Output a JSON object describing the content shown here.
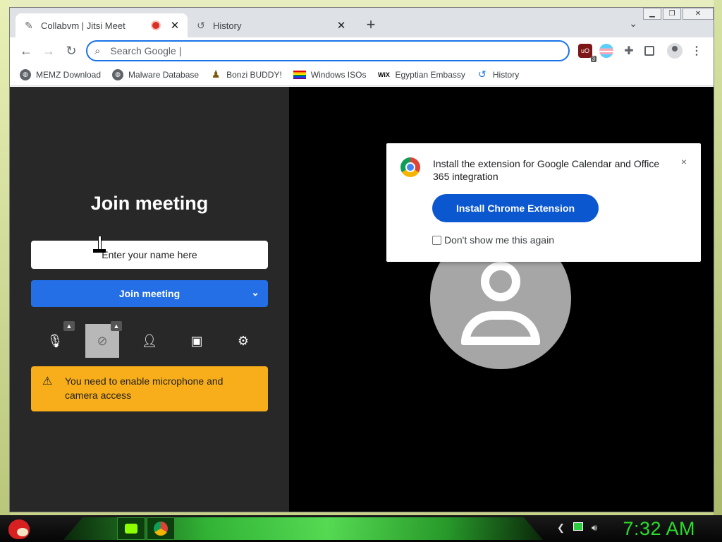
{
  "browser": {
    "tabs": [
      {
        "title": "Collabvm | Jitsi Meet",
        "active": true,
        "recording": true
      },
      {
        "title": "History",
        "active": false
      }
    ],
    "omnibox": {
      "placeholder": "Search Google |",
      "value": ""
    },
    "extensions": {
      "ublock_badge": "3"
    },
    "bookmarks": [
      {
        "label": "MEMZ Download",
        "icon": "globe-icon"
      },
      {
        "label": "Malware Database",
        "icon": "globe-icon"
      },
      {
        "label": "Bonzi BUDDY!",
        "icon": "bonzi-icon"
      },
      {
        "label": "Windows ISOs",
        "icon": "rainbow-flag-icon"
      },
      {
        "label": "Egyptian Embassy",
        "icon": "wix-icon",
        "icon_text": "WiX"
      },
      {
        "label": "History",
        "icon": "history-icon"
      }
    ]
  },
  "jitsi": {
    "title": "Join meeting",
    "name_placeholder": "Enter your name here",
    "join_button": "Join meeting",
    "warning": "You need to enable microphone and camera access",
    "popup": {
      "text": "Install the extension for Google Calendar and Office 365 integration",
      "button": "Install Chrome Extension",
      "checkbox_label": "Don't show me this again",
      "close_glyph": "×"
    }
  },
  "taskbar": {
    "clock": "7:32 AM"
  },
  "colors": {
    "accent_blue": "#246fe5",
    "warning_orange": "#f8ae1a",
    "popup_button": "#0b57d0",
    "clock_green": "#2bdc2b"
  }
}
